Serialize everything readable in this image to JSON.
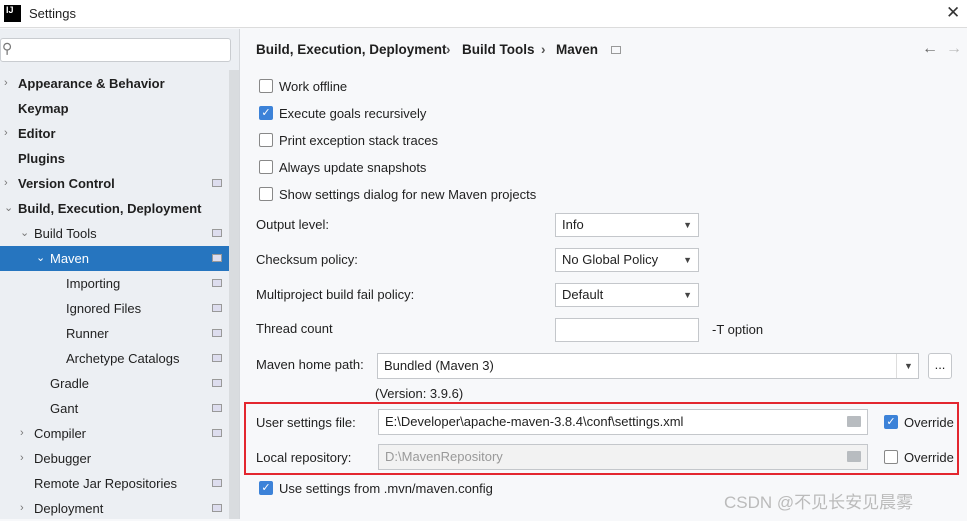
{
  "window": {
    "title": "Settings",
    "logo": "IJ"
  },
  "sidebar": {
    "search_placeholder": "",
    "items": [
      {
        "label": "Appearance & Behavior",
        "bold": true,
        "arrow": "›",
        "indent": 0
      },
      {
        "label": "Keymap",
        "bold": true,
        "arrow": "",
        "indent": 0
      },
      {
        "label": "Editor",
        "bold": true,
        "arrow": "›",
        "indent": 0
      },
      {
        "label": "Plugins",
        "bold": true,
        "arrow": "",
        "indent": 0
      },
      {
        "label": "Version Control",
        "bold": true,
        "arrow": "›",
        "indent": 0,
        "page": true
      },
      {
        "label": "Build, Execution, Deployment",
        "bold": true,
        "arrow": "⌄",
        "indent": 0
      },
      {
        "label": "Build Tools",
        "arrow": "⌄",
        "indent": 1,
        "page": true
      },
      {
        "label": "Maven",
        "arrow": "⌄",
        "indent": 2,
        "page": true,
        "selected": true
      },
      {
        "label": "Importing",
        "arrow": "",
        "indent": 4,
        "page": true
      },
      {
        "label": "Ignored Files",
        "arrow": "",
        "indent": 4,
        "page": true
      },
      {
        "label": "Runner",
        "arrow": "",
        "indent": 4,
        "page": true
      },
      {
        "label": "Archetype Catalogs",
        "arrow": "",
        "indent": 4,
        "page": true
      },
      {
        "label": "Gradle",
        "arrow": "",
        "indent": 2,
        "page": true
      },
      {
        "label": "Gant",
        "arrow": "",
        "indent": 2,
        "page": true
      },
      {
        "label": "Compiler",
        "arrow": "›",
        "indent": 1,
        "page": true
      },
      {
        "label": "Debugger",
        "arrow": "›",
        "indent": 1
      },
      {
        "label": "Remote Jar Repositories",
        "arrow": "",
        "indent": 1,
        "page": true
      },
      {
        "label": "Deployment",
        "arrow": "›",
        "indent": 1,
        "page": true
      }
    ]
  },
  "breadcrumb": [
    "Build, Execution, Deployment",
    "Build Tools",
    "Maven"
  ],
  "checkboxes": [
    {
      "label": "Work offline",
      "checked": false
    },
    {
      "label": "Execute goals recursively",
      "checked": true
    },
    {
      "label": "Print exception stack traces",
      "checked": false
    },
    {
      "label": "Always update snapshots",
      "checked": false
    },
    {
      "label": "Show settings dialog for new Maven projects",
      "checked": false
    }
  ],
  "form": {
    "output_level": {
      "label": "Output level:",
      "value": "Info"
    },
    "checksum": {
      "label": "Checksum policy:",
      "value": "No Global Policy"
    },
    "multiproject": {
      "label": "Multiproject build fail policy:",
      "value": "Default"
    },
    "thread": {
      "label": "Thread count",
      "value": "",
      "suffix": "-T option"
    },
    "home": {
      "label": "Maven home path:",
      "value": "Bundled (Maven 3)",
      "browse": "...",
      "version": "(Version: 3.9.6)"
    },
    "user_settings": {
      "label": "User settings file:",
      "value": "E:\\Developer\\apache-maven-3.8.4\\conf\\settings.xml",
      "override_label": "Override",
      "override": true
    },
    "local_repo": {
      "label": "Local repository:",
      "value": "D:\\MavenRepository",
      "override_label": "Override",
      "override": false
    },
    "use_mvn_config": {
      "label": "Use settings from .mvn/maven.config",
      "checked": true
    }
  },
  "watermark": "CSDN @不见长安见晨雾",
  "colors": {
    "selection": "#2675bf",
    "highlight_box": "#e3262f",
    "checkbox": "#3c82d8"
  }
}
